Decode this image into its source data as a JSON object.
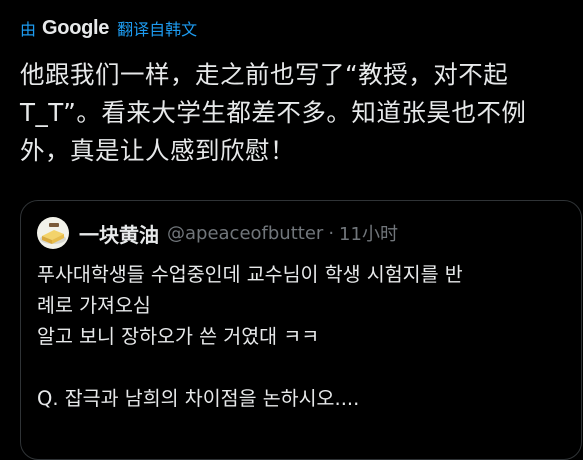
{
  "translation": {
    "by_label": "由",
    "provider": "Google",
    "translated_from": "翻译自韩文"
  },
  "tweet": {
    "text": "他跟我们一样，走之前也写了“教授，对不起T_T”。看来大学生都差不多。知道张昊也不例外，真是让人感到欣慰！"
  },
  "quoted_tweet": {
    "display_name": "一块黄油",
    "handle": "@apeaceofbutter",
    "separator": "·",
    "time": "11小时",
    "lines": [
      "푸사대학생들 수업중인데 교수님이 학생 시험지를 반",
      "례로 가져오심",
      "알고 보니 장하오가 쓴 거였대 ㅋㅋ",
      "",
      "Q. 잡극과 남희의 차이점을 논하시오...."
    ]
  },
  "colors": {
    "background": "#000000",
    "text_primary": "#e7e9ea",
    "text_secondary": "#71767b",
    "link_blue": "#1d9bf0",
    "border": "#2f3336"
  },
  "icons": {
    "avatar": "butter-avatar-icon"
  }
}
